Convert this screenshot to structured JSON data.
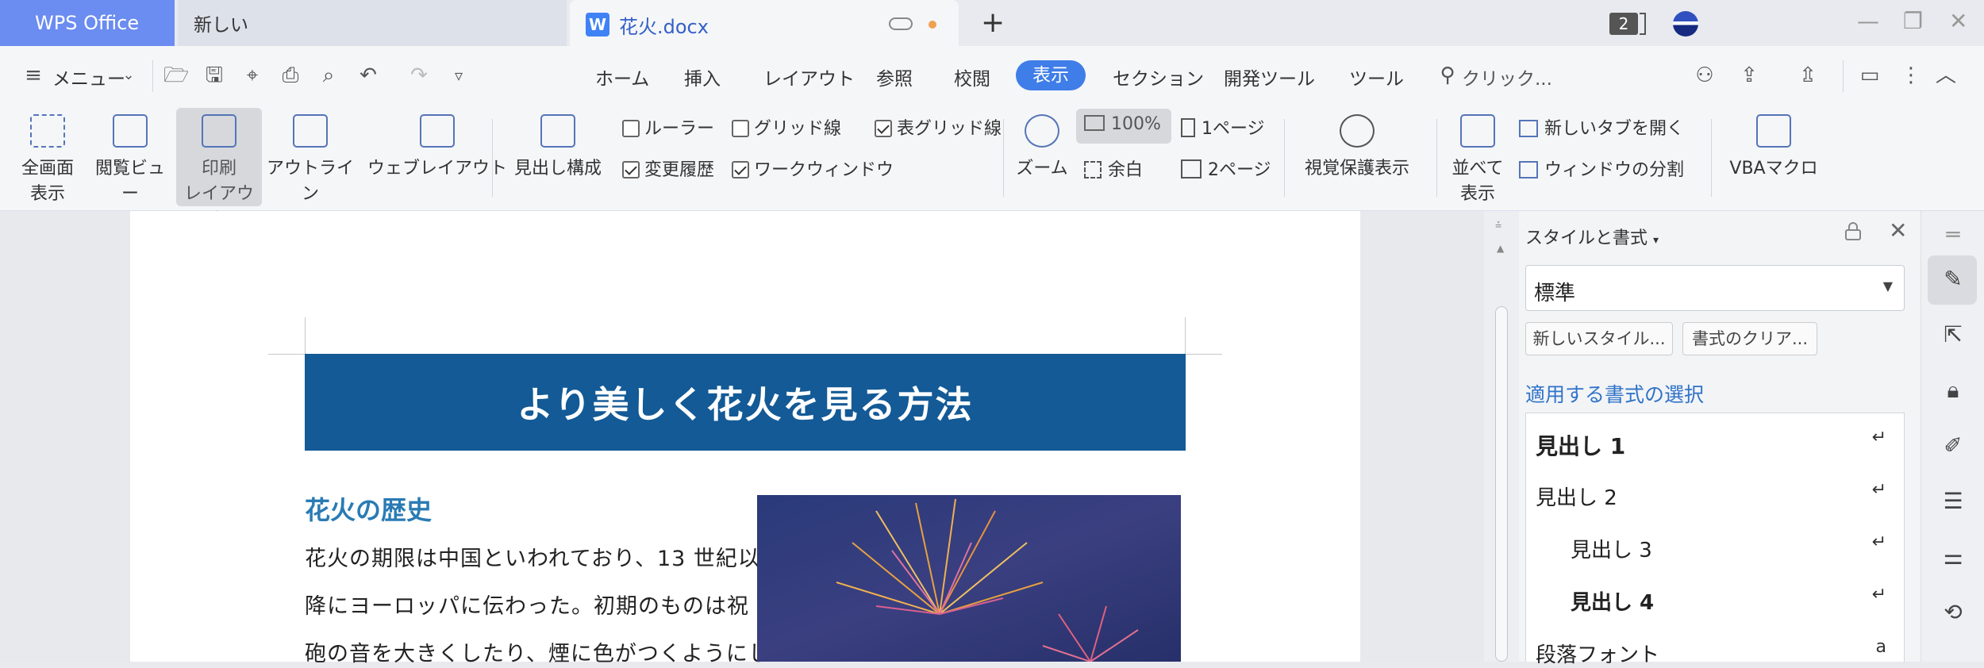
{
  "tabs": {
    "app": "WPS Office",
    "new_tab": "新しい",
    "doc_badge": "W",
    "doc_name": "花火.docx",
    "window_count": "2"
  },
  "menu": {
    "menu_label": "メニュー",
    "tabs": [
      "ホーム",
      "挿入",
      "レイアウト",
      "参照",
      "校閲",
      "表示",
      "セクション",
      "開発ツール",
      "ツール"
    ],
    "active_tab": "表示",
    "search_placeholder": "クリック..."
  },
  "ribbon": {
    "fullscreen": [
      "全画面",
      "表示"
    ],
    "reading_view": "閲覧ビュー",
    "print_layout": [
      "印刷",
      "レイアウト"
    ],
    "outline": "アウトライン",
    "web_layout": "ウェブレイアウト",
    "heading_structure": "見出し構成",
    "ruler": "ルーラー",
    "gridlines": "グリッド線",
    "table_gridlines": "表グリッド線",
    "track_changes": "変更履歴",
    "task_window": "ワークウィンドウ",
    "zoom": "ズーム",
    "zoom_100": "100%",
    "one_page": "1ページ",
    "margins": "余白",
    "two_page": "2ページ",
    "eye_protection": "視覚保護表示",
    "arrange_all": [
      "並べて",
      "表示"
    ],
    "new_window": "新しいタブを開く",
    "split_window": "ウィンドウの分割",
    "vba_macro": "VBAマクロ",
    "checkbox_states": {
      "ruler": false,
      "gridlines": false,
      "table_gridlines": true,
      "track_changes": true,
      "task_window": true
    }
  },
  "document": {
    "title": "より美しく花火を見る方法",
    "section_heading": "花火の歴史",
    "lines": [
      "花火の期限は中国といわれており、13 世紀以",
      "降にヨーロッパに伝わった。初期のものは祝",
      "砲の音を大きくしたり、煙に色がつくようにし"
    ]
  },
  "style_panel": {
    "title": "スタイルと書式",
    "current_style": "標準",
    "new_style_button": "新しいスタイル...",
    "clear_format_button": "書式のクリア...",
    "apply_label": "適用する書式の選択",
    "styles": [
      "見出し 1",
      "見出し 2",
      "見出し 3",
      "見出し 4",
      "段落フォント"
    ],
    "style_marks": [
      "↵",
      "↵",
      "↵",
      "↵",
      "a"
    ]
  },
  "colors": {
    "accent": "#3f7de8",
    "title_band": "#135a96",
    "section_heading": "#2a7bb4",
    "wps_tab": "#6b8cf0"
  }
}
